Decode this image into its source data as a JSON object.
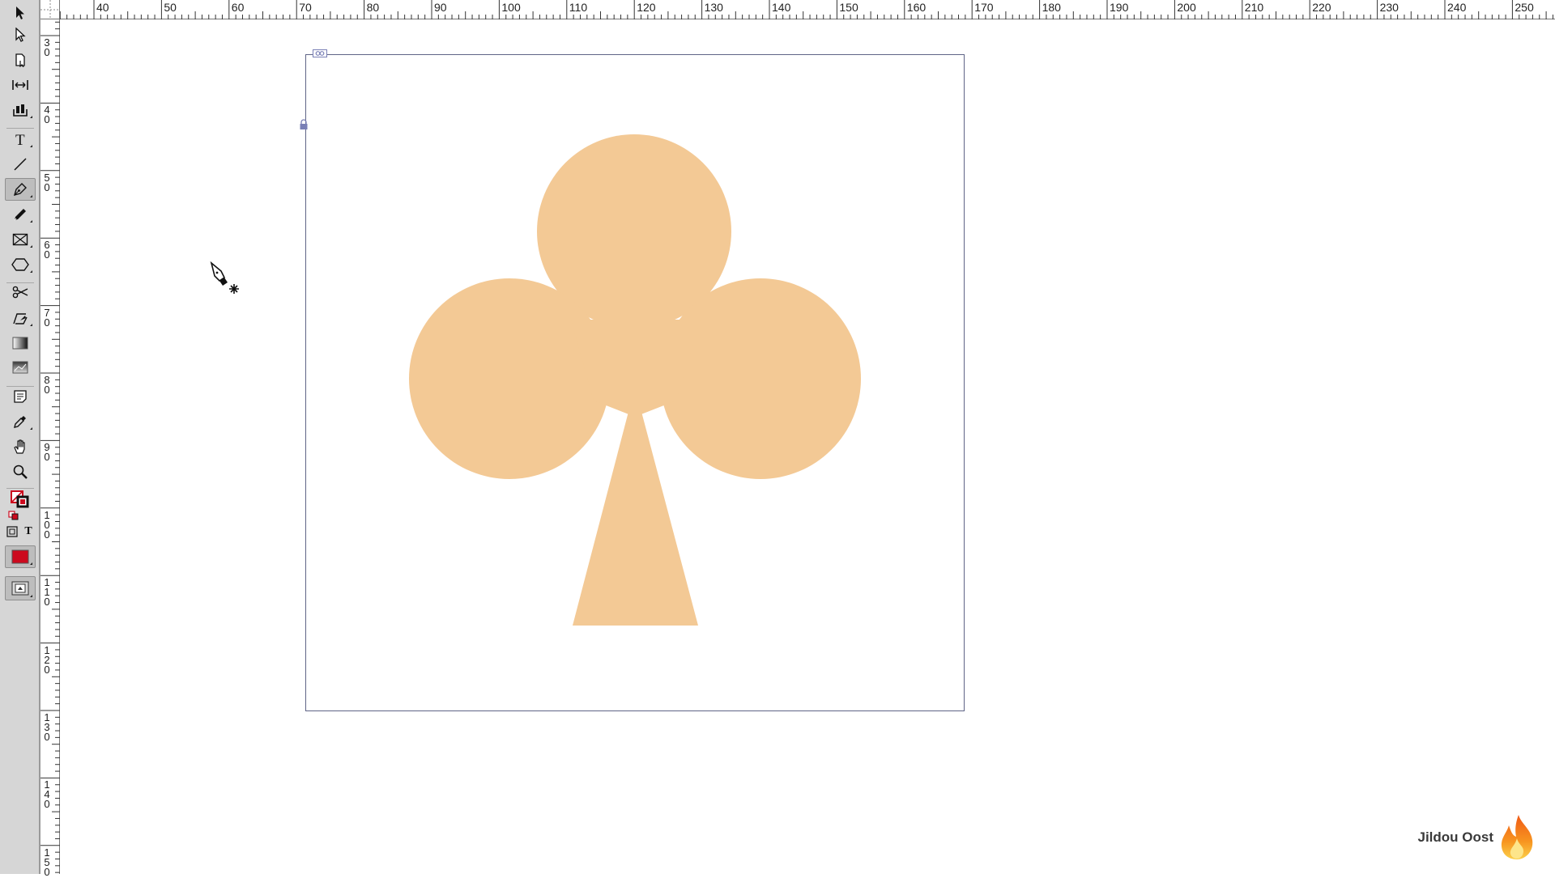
{
  "toolbar": {
    "tools": [
      {
        "name": "selection-tool-button",
        "icon": "selection-arrow-icon"
      },
      {
        "name": "direct-selection-tool-button",
        "icon": "direct-selection-arrow-icon"
      },
      {
        "name": "page-tool-button",
        "icon": "page-icon"
      },
      {
        "name": "gap-tool-button",
        "icon": "gap-icon"
      },
      {
        "name": "content-collector-tool-button",
        "icon": "content-collector-icon"
      },
      {
        "name": "type-tool-button",
        "icon": "type-icon"
      },
      {
        "name": "line-tool-button",
        "icon": "line-icon"
      },
      {
        "name": "pen-tool-button",
        "icon": "pen-icon",
        "active": true
      },
      {
        "name": "pencil-tool-button",
        "icon": "pencil-icon"
      },
      {
        "name": "rectangle-frame-tool-button",
        "icon": "rectangle-frame-icon"
      },
      {
        "name": "polygon-tool-button",
        "icon": "polygon-icon"
      },
      {
        "name": "scissors-tool-button",
        "icon": "scissors-icon"
      },
      {
        "name": "free-transform-tool-button",
        "icon": "free-transform-icon"
      },
      {
        "name": "gradient-swatch-tool-button",
        "icon": "gradient-swatch-icon"
      },
      {
        "name": "gradient-feather-tool-button",
        "icon": "gradient-feather-icon"
      },
      {
        "name": "note-tool-button",
        "icon": "note-icon"
      },
      {
        "name": "eyedropper-tool-button",
        "icon": "eyedropper-icon"
      },
      {
        "name": "hand-tool-button",
        "icon": "hand-icon"
      },
      {
        "name": "zoom-tool-button",
        "icon": "zoom-icon"
      }
    ],
    "type_toggle_label": "T",
    "fill_color": "#cc0a1e",
    "stroke_color": "#cc0a1e"
  },
  "ruler_top": {
    "labels": [
      "40",
      "50",
      "60",
      "70",
      "80",
      "90",
      "100",
      "110",
      "120",
      "130",
      "140",
      "150",
      "160",
      "170",
      "180",
      "190",
      "200",
      "210",
      "220",
      "230",
      "240",
      "250"
    ]
  },
  "ruler_left": {
    "labels": [
      "30",
      "40",
      "50",
      "60",
      "70",
      "80",
      "90",
      "100",
      "110",
      "120",
      "130",
      "140",
      "150"
    ]
  },
  "document": {
    "frame_stroke_color": "#5f6486",
    "shape_fill_color": "#f3c995",
    "shape_icon": "club-suit-shape"
  },
  "cursor": {
    "icon": "pen-tool-cursor-icon"
  },
  "watermark": {
    "name": "Jildou Oost",
    "icon": "flame-logo-icon"
  }
}
